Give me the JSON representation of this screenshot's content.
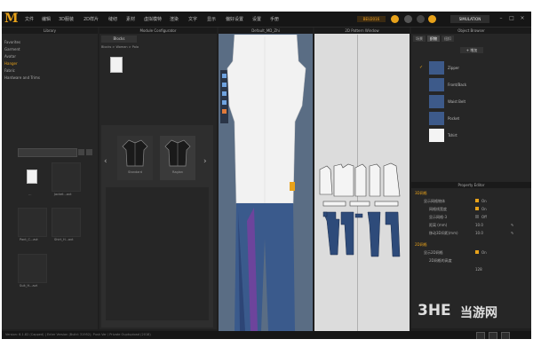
{
  "menu": [
    "文件",
    "编辑",
    "3D服装",
    "2D样片",
    "缝纫",
    "素材",
    "虚拟模特",
    "渲染",
    "文字",
    "显示",
    "偏好设置",
    "设置",
    "手册"
  ],
  "user_badge": "BEU2016",
  "sim_label": "SIMULATION",
  "library": {
    "title": "Library",
    "items": [
      "Favorites",
      "Garment",
      "Avatar",
      "Hanger",
      "Fabric",
      "Hardware and Trims"
    ]
  },
  "module": {
    "title": "Module Configurator",
    "tab": "Blocks",
    "breadcrumb": "Blocks > Woman > Polo",
    "styles": [
      "Standard",
      "Raglan"
    ]
  },
  "files": [
    "Jacket...avt",
    "Pant_C...avt",
    "Shirt_H...avt",
    "Suit_H...avt"
  ],
  "view3d": {
    "title": "Default_MD_Zhi"
  },
  "view2d": {
    "title": "2D Pattern Window"
  },
  "object_browser": {
    "title": "Object Browser",
    "tabs": [
      "场景",
      "织物",
      "纽扣"
    ],
    "add_label": "+ 增加",
    "items": [
      {
        "name": "Zipper",
        "color": "#3d5a8a"
      },
      {
        "name": "Front/Back",
        "color": "#3d5a8a"
      },
      {
        "name": "Waist Belt",
        "color": "#3d5a8a"
      },
      {
        "name": "Pocket",
        "color": "#3d5a8a"
      },
      {
        "name": "Tshirt",
        "color": "#f4f4f4"
      }
    ]
  },
  "property_editor": {
    "title": "Property Editor",
    "section1": "3D网格",
    "rows1": [
      {
        "label": "显示网格物体",
        "value": "On"
      },
      {
        "label": "网格线宽度",
        "value": "On"
      },
      {
        "label": "显示网格-3",
        "value": "Off"
      },
      {
        "label": "距离 (mm)",
        "value": "10.0"
      },
      {
        "label": "移动3D间距(mm)",
        "value": "10.0"
      }
    ],
    "section2": "2D网格",
    "rows2": [
      {
        "label": "显示2D网格",
        "value": "On"
      },
      {
        "label": "2D网格的高度",
        "value": ""
      }
    ],
    "extra_value": "128"
  },
  "status_text": "Version: 6.1.82 (Capped) | Enter Version (Build: 31952); Push Ver / Private Ouptupload (2018)",
  "watermark": {
    "big": "3HE",
    "site": "当游网"
  },
  "accent": "#e8a21a",
  "denim": "#2e4b7a"
}
